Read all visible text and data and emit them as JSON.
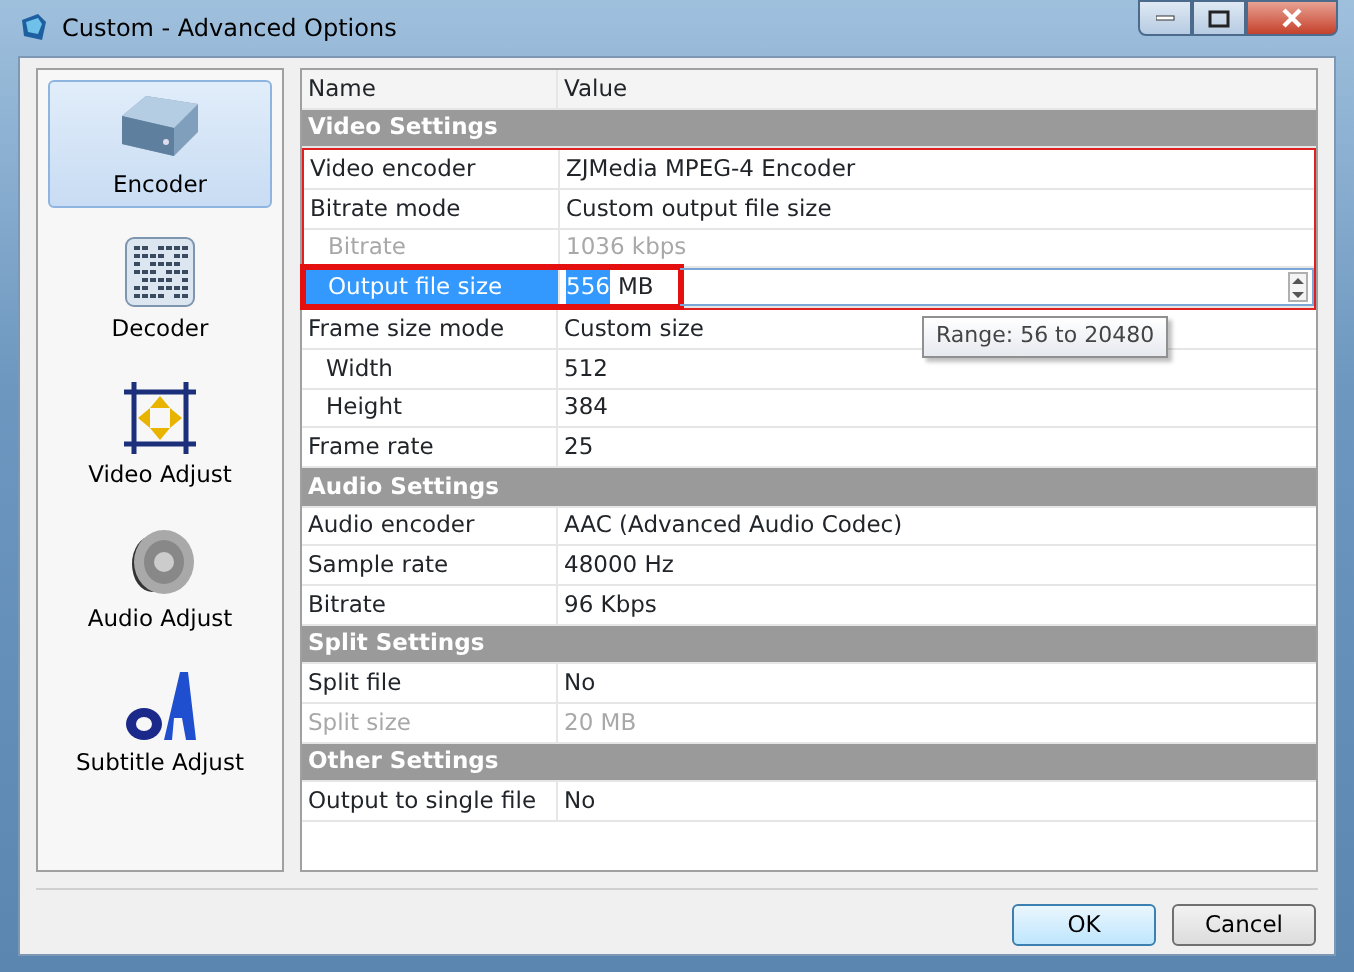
{
  "window": {
    "title": "Custom - Advanced Options"
  },
  "sidebar": {
    "items": [
      {
        "label": "Encoder",
        "kind": "drive",
        "selected": true
      },
      {
        "label": "Decoder",
        "kind": "panel",
        "selected": false
      },
      {
        "label": "Video Adjust",
        "kind": "frame",
        "selected": false
      },
      {
        "label": "Audio Adjust",
        "kind": "speaker",
        "selected": false
      },
      {
        "label": "Subtitle Adjust",
        "kind": "letters",
        "selected": false
      }
    ]
  },
  "grid": {
    "columns": [
      "Name",
      "Value"
    ],
    "sections": [
      {
        "title": "Video Settings",
        "rows": [
          {
            "name": "Video encoder",
            "value": "ZJMedia MPEG-4 Encoder",
            "outlined": true
          },
          {
            "name": "Bitrate mode",
            "value": "Custom output file size",
            "outlined": true,
            "children": [
              {
                "name": "Bitrate",
                "value": "1036 kbps",
                "disabled": true,
                "outlined": true
              },
              {
                "name": "Output file size",
                "value": "556",
                "unit": "MB",
                "editing": true,
                "marked": true,
                "outlined": true
              }
            ]
          },
          {
            "name": "Frame size mode",
            "value": "Custom size",
            "children": [
              {
                "name": "Width",
                "value": "512"
              },
              {
                "name": "Height",
                "value": "384"
              }
            ]
          },
          {
            "name": "Frame rate",
            "value": "25"
          }
        ]
      },
      {
        "title": "Audio Settings",
        "rows": [
          {
            "name": "Audio encoder",
            "value": "AAC (Advanced Audio Codec)"
          },
          {
            "name": "Sample rate",
            "value": "48000 Hz"
          },
          {
            "name": "Bitrate",
            "value": "96 Kbps"
          }
        ]
      },
      {
        "title": "Split Settings",
        "rows": [
          {
            "name": "Split file",
            "value": "No"
          },
          {
            "name": "Split size",
            "value": "20 MB",
            "disabled": true
          }
        ]
      },
      {
        "title": "Other Settings",
        "rows": [
          {
            "name": "Output to single file",
            "value": "No"
          }
        ]
      }
    ]
  },
  "tooltip": "Range: 56 to 20480",
  "buttons": [
    {
      "label": "OK",
      "default": true
    },
    {
      "label": "Cancel",
      "default": false
    }
  ]
}
